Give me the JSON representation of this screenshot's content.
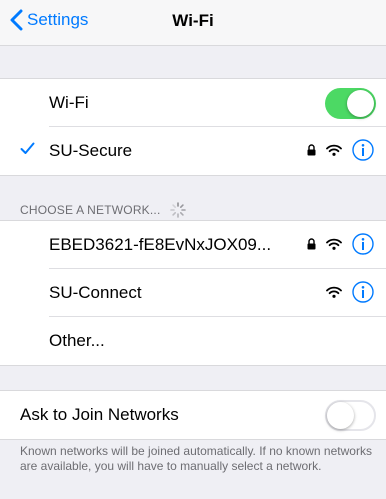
{
  "nav": {
    "back_label": "Settings",
    "title": "Wi-Fi"
  },
  "wifi_row": {
    "label": "Wi-Fi",
    "toggle_on": true
  },
  "connected_network": {
    "name": "SU-Secure",
    "checked": true,
    "locked": true
  },
  "networks_section": {
    "header": "CHOOSE A NETWORK..."
  },
  "networks": [
    {
      "name": "EBED3621-fE8EvNxJOX09...",
      "locked": true
    },
    {
      "name": "SU-Connect",
      "locked": false
    },
    {
      "name": "Other..."
    }
  ],
  "ask_to_join": {
    "label": "Ask to Join Networks",
    "toggle_on": false,
    "footer": "Known networks will be joined automatically. If no known networks are available, you will have to manually select a network."
  },
  "colors": {
    "accent": "#007aff",
    "toggle_on": "#4cd964",
    "background": "#efeff4"
  },
  "icons": {
    "back": "chevron-left-icon",
    "check": "checkmark-icon",
    "lock": "lock-icon",
    "wifi": "wifi-icon",
    "info": "info-icon",
    "spinner": "spinner-icon"
  }
}
